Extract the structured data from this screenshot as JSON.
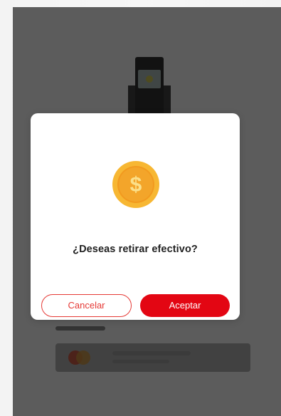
{
  "dialog": {
    "question": "¿Deseas retirar efectivo?",
    "cancel_label": "Cancelar",
    "accept_label": "Aceptar",
    "coin_symbol": "$"
  },
  "icons": {
    "coin": "dollar-coin-icon",
    "atm": "atm-icon",
    "card_brand": "mastercard-icon"
  },
  "colors": {
    "accent": "#e30613",
    "cancel_border": "#e53935",
    "coin_gold": "#f5a623",
    "overlay": "rgba(0,0,0,0.58)"
  }
}
